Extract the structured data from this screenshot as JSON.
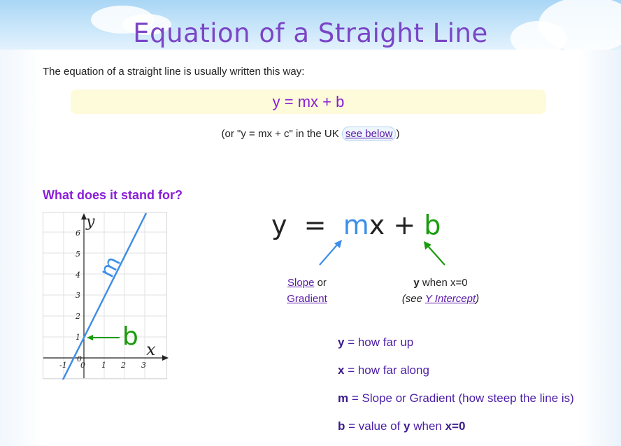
{
  "header": {
    "title": "Equation of a Straight Line"
  },
  "intro": {
    "text": "The equation of a straight line is usually written this way:"
  },
  "formula": {
    "text": "y = mx + b"
  },
  "uk_note": {
    "prefix": "(or \"y = mx + c\" in the UK ",
    "link": "see below",
    "suffix": ")"
  },
  "section": {
    "title": "What does it stand for?"
  },
  "graph": {
    "y_axis_label": "y",
    "x_axis_label": "x",
    "line_label": "m",
    "intercept_label": "b",
    "y_ticks": [
      "1",
      "2",
      "3",
      "4",
      "5",
      "6"
    ],
    "x_ticks": [
      "-1",
      "0",
      "1",
      "2",
      "3"
    ],
    "origin_label": "0",
    "line_color": "#3d8ee8",
    "intercept_color": "#1a9c0c"
  },
  "equation": {
    "y": "y",
    "equals": "=",
    "m": "m",
    "x": "x",
    "plus": "+",
    "b": "b"
  },
  "slope_label": {
    "slope_link": "Slope",
    "or": " or",
    "gradient_link": "Gradient"
  },
  "yint_label": {
    "y": "y",
    "when": " when x=0",
    "see_open": "(see ",
    "link": "Y Intercept",
    "see_close": ")"
  },
  "definitions": [
    {
      "term": "y",
      "text": " = how far up"
    },
    {
      "term": "x",
      "text": " = how far along"
    },
    {
      "term": "m",
      "text": " = Slope or Gradient (how steep the line is)"
    },
    {
      "term": "b",
      "text": " = value of ",
      "term2": "y",
      "text2": " when ",
      "term3": "x=0"
    }
  ],
  "colors": {
    "title_purple": "#7b45c6",
    "accent_purple": "#8a1ed8",
    "slope_blue": "#3d8ee8",
    "intercept_green": "#1a9c0c"
  }
}
